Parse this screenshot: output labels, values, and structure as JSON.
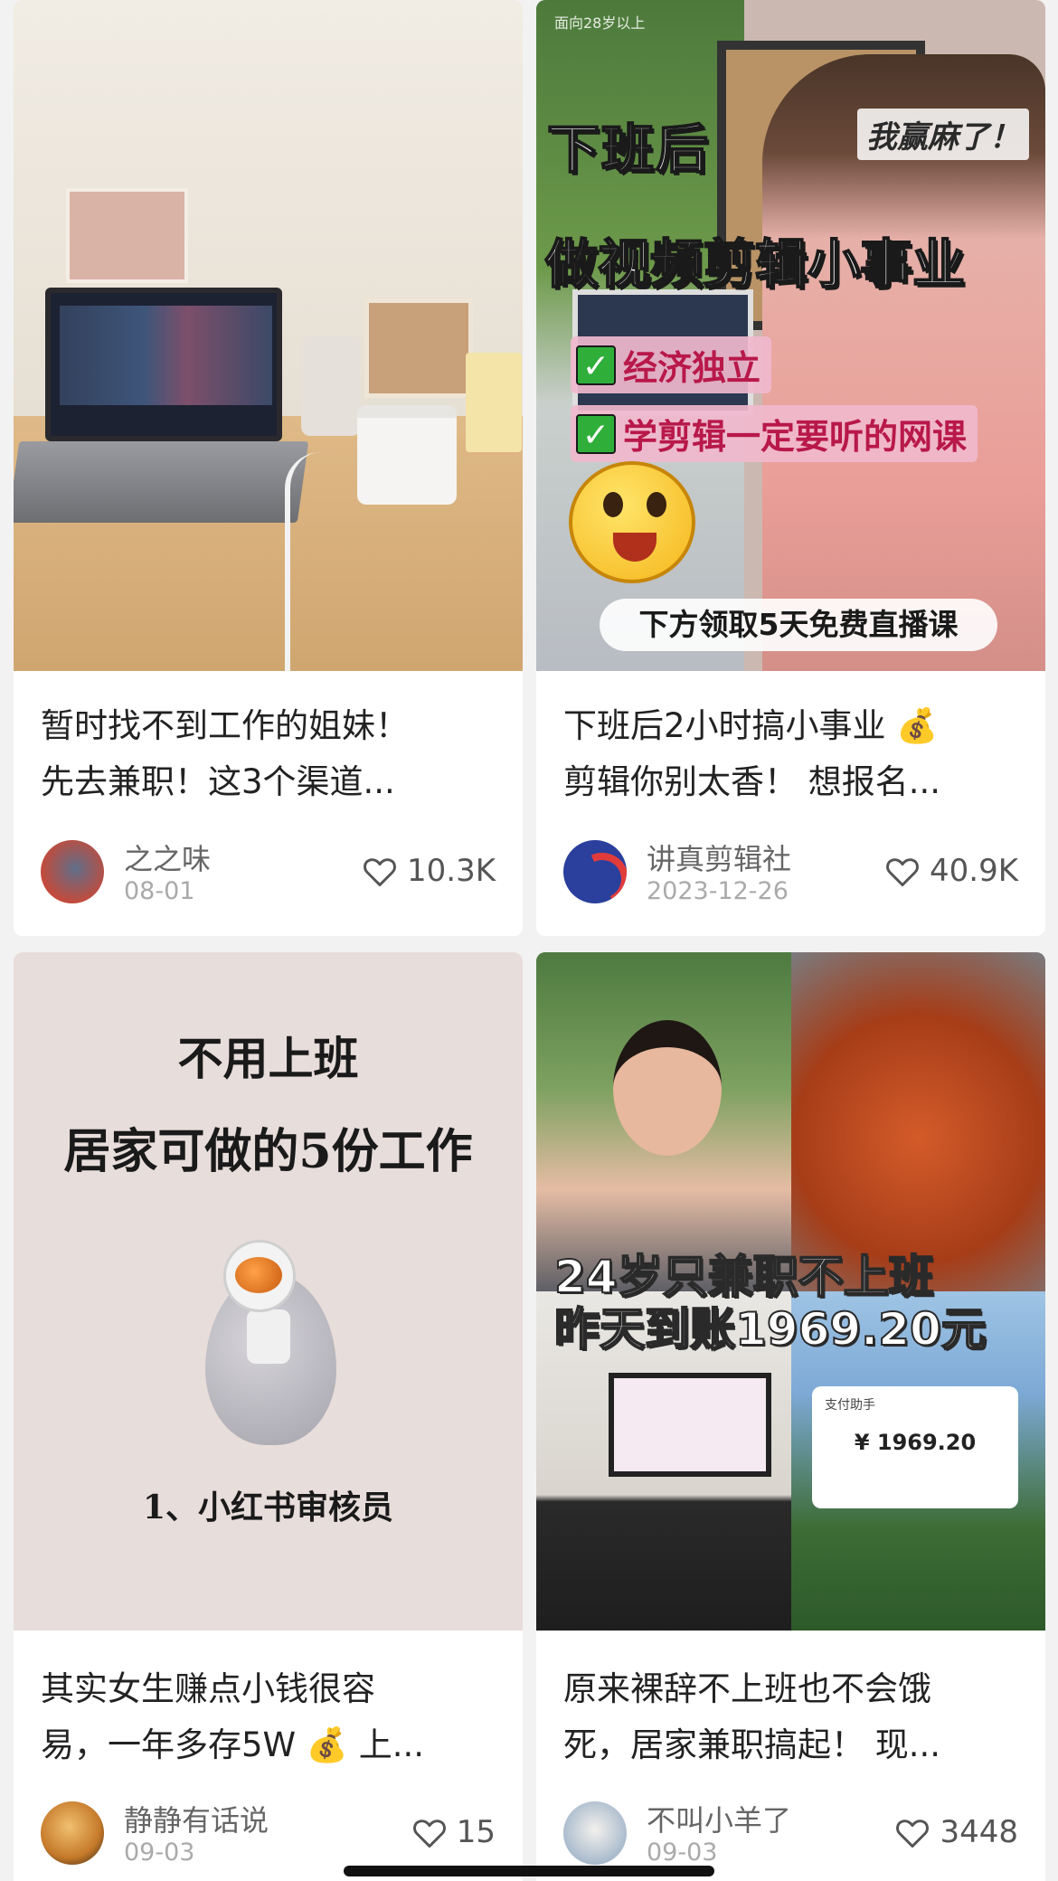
{
  "feed": {
    "cards": [
      {
        "title_lines": [
          "暂时找不到工作的姐妹！",
          "先去兼职！这3个渠道..."
        ],
        "author": "之之味",
        "date": "08-01",
        "likes": "10.3K",
        "thumb": {}
      },
      {
        "title_lines": [
          "下班后2小时搞小事业 💰",
          "剪辑你别太香！ 想报名..."
        ],
        "author": "讲真剪辑社",
        "date": "2023-12-26",
        "likes": "40.9K",
        "thumb": {
          "watermark": "面向28岁以上",
          "headline1": "下班后",
          "headline2": "做视频剪辑小事业",
          "badge": "我赢麻了！",
          "check1": "经济独立",
          "check2": "学剪辑一定要听的网课",
          "banner": "下方领取5天免费直播课"
        }
      },
      {
        "title_lines": [
          "其实女生赚点小钱很容",
          "易，一年多存5W 💰 上..."
        ],
        "author": "静静有话说",
        "date": "09-03",
        "likes": "15",
        "thumb": {
          "line1": "不用上班",
          "line2": "居家可做的5份工作",
          "line3": "1、小红书审核员"
        }
      },
      {
        "title_lines": [
          "原来裸辞不上班也不会饿",
          "死，居家兼职搞起！ 现..."
        ],
        "author": "不叫小羊了",
        "date": "09-03",
        "likes": "3448",
        "thumb": {
          "overlay1": "24岁只兼职不上班",
          "overlay2": "昨天到账1969.20元",
          "receipt_amount": "¥ 1969.20",
          "receipt_title": "支付助手"
        }
      }
    ]
  },
  "icons": {
    "like": "heart-outline-icon"
  }
}
